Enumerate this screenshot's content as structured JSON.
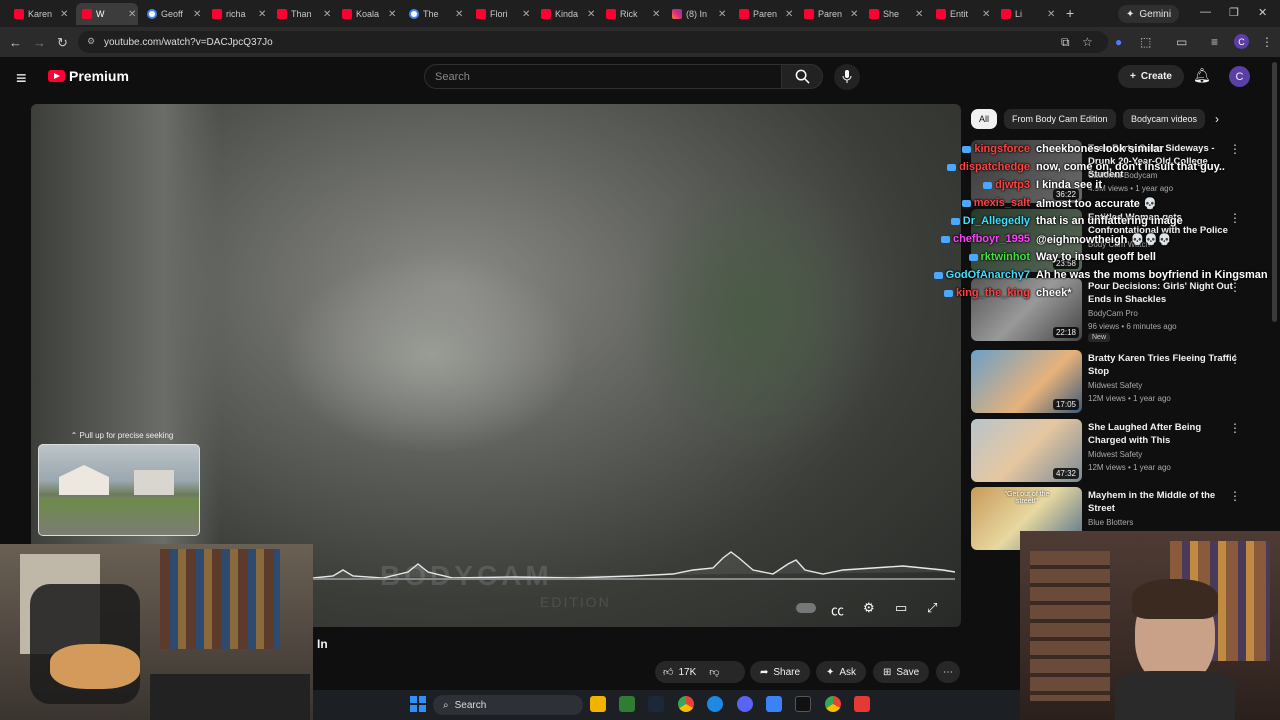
{
  "browser": {
    "tabs": [
      {
        "label": "Karen",
        "icon": "youtube-icon"
      },
      {
        "label": "W",
        "icon": "youtube-icon",
        "active": true
      },
      {
        "label": "Geoff",
        "icon": "google-icon"
      },
      {
        "label": "richa",
        "icon": "youtube-icon"
      },
      {
        "label": "Than",
        "icon": "youtube-icon"
      },
      {
        "label": "Koala",
        "icon": "youtube-icon"
      },
      {
        "label": "The",
        "icon": "google-icon"
      },
      {
        "label": "Flori",
        "icon": "youtube-icon"
      },
      {
        "label": "Kinda",
        "icon": "youtube-icon"
      },
      {
        "label": "Rick",
        "icon": "youtube-icon"
      },
      {
        "label": "(8) In",
        "icon": "instagram-icon"
      },
      {
        "label": "Paren",
        "icon": "youtube-icon"
      },
      {
        "label": "Paren",
        "icon": "youtube-icon"
      },
      {
        "label": "She",
        "icon": "youtube-icon"
      },
      {
        "label": "Entit",
        "icon": "youtube-icon"
      },
      {
        "label": "Li",
        "icon": "youtube-icon"
      }
    ],
    "gemini_label": "Gemini",
    "url": "youtube.com/watch?v=DACJpcQ37Jo",
    "profile_initial": "C"
  },
  "youtube": {
    "logo_text": "Premium",
    "search_placeholder": "Search",
    "create_label": "Create",
    "avatar_initial": "C"
  },
  "player": {
    "watermark": "BODYCAM",
    "watermark_sub": "EDITION",
    "seek_hint": "Pull up for precise seeking"
  },
  "chat": [
    {
      "user": "kingsforce",
      "text": "cheekbones look similar",
      "color": "#ff4040"
    },
    {
      "user": "dispatchedge",
      "text": "now, come on, don't insult that guy..",
      "color": "#ff4040"
    },
    {
      "user": "djwtp3",
      "text": "I kinda see it",
      "color": "#ff4040"
    },
    {
      "user": "mexis_salt",
      "text": "almost too accurate 💀",
      "color": "#ff4040"
    },
    {
      "user": "Dr_Allegedly",
      "text": "that is an unflattering image",
      "color": "#3fe0ff"
    },
    {
      "user": "chefboyr_1995",
      "text": "@eighmowtheigh 💀💀💀",
      "color": "#ff40ff"
    },
    {
      "user": "rktwinhot",
      "text": "Way to insult geoff bell",
      "color": "#40e040"
    },
    {
      "user": "GodOfAnarchy7",
      "text": "Ah he was the moms boyfriend in Kingsman",
      "color": "#3fe0ff"
    },
    {
      "user": "king_the_king",
      "text": "cheek*",
      "color": "#ff4040"
    }
  ],
  "chips": [
    "All",
    "From Body Cam Edition",
    "Bodycam videos"
  ],
  "recommendations": [
    {
      "title": "Teen Party Gone Sideways - Drunk 20-Year-Old College Student",
      "channel": "California Bodycam",
      "meta": "4.9M views • 1 year ago",
      "duration": "36:22"
    },
    {
      "title": "Entitled Woman gets Confrontational with the Police",
      "channel": "Body Cam Watch",
      "meta": "",
      "duration": "23:58"
    },
    {
      "title": "Pour Decisions: Girls' Night Out Ends in Shackles",
      "channel": "BodyCam Pro",
      "meta": "96 views • 6 minutes ago",
      "duration": "22:18",
      "badge": "New"
    },
    {
      "title": "Bratty Karen Tries Fleeing Traffic Stop",
      "channel": "Midwest Safety",
      "meta": "12M views • 1 year ago",
      "duration": "17:05"
    },
    {
      "title": "She Laughed After Being Charged with This",
      "channel": "Midwest Safety",
      "meta": "12M views • 1 year ago",
      "duration": "47:32"
    },
    {
      "title": "Mayhem in the Middle of the Street",
      "channel": "Blue Blotters",
      "meta": "",
      "duration": "",
      "thumb_text": "\"Get out of the street!\""
    }
  ],
  "below_player": {
    "title_fragment": "In",
    "like_count": "17K",
    "share_label": "Share",
    "ask_label": "Ask",
    "save_label": "Save"
  },
  "taskbar": {
    "search_label": "Search"
  }
}
